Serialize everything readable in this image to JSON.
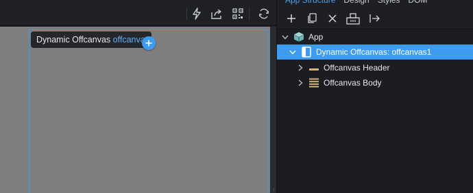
{
  "canvas": {
    "element_label_type": "Dynamic Offcanvas",
    "element_label_id": "offcanvas1",
    "toolbar_icons": [
      "lightning-icon",
      "share-icon",
      "qr-code-icon",
      "refresh-icon"
    ]
  },
  "panel": {
    "tabs": [
      {
        "label": "App Structure",
        "active": true
      },
      {
        "label": "Design",
        "active": false
      },
      {
        "label": "Styles",
        "active": false
      },
      {
        "label": "DOM",
        "active": false
      }
    ],
    "toolbar_icons": [
      "plus-icon",
      "duplicate-icon",
      "close-icon",
      "wrap-icon",
      "export-icon"
    ],
    "tree": [
      {
        "label": "App",
        "icon": "cube-icon",
        "expanded": true,
        "selected": false
      },
      {
        "label": "Dynamic Offcanvas: offcanvas1",
        "icon": "offcanvas-icon",
        "expanded": true,
        "selected": true
      },
      {
        "label": "Offcanvas Header",
        "icon": "header-icon",
        "expanded": false,
        "selected": false
      },
      {
        "label": "Offcanvas Body",
        "icon": "body-icon",
        "expanded": false,
        "selected": false
      }
    ]
  },
  "colors": {
    "accent": "#3d9bf0",
    "canvas_bg": "#7e7e7e",
    "panel_bg": "#1e1f24",
    "id_text": "#5ab2f2",
    "component_icon": "#d8b57a",
    "app_icon": "#8fc7c9"
  }
}
